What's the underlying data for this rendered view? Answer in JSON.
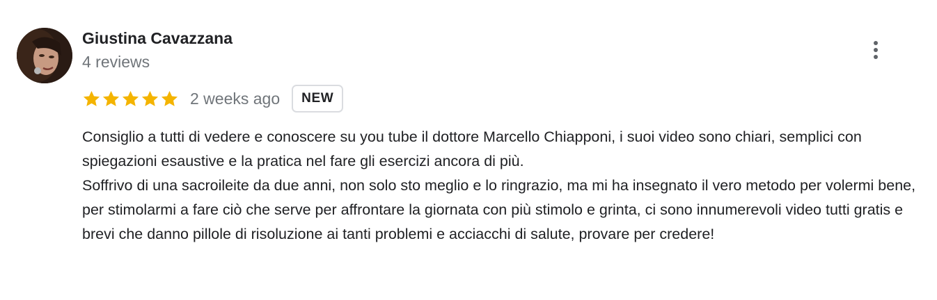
{
  "review": {
    "author_name": "Giustina Cavazzana",
    "review_count": "4 reviews",
    "rating": 5,
    "rating_max": 5,
    "star_color": "#f4b400",
    "time_ago": "2 weeks ago",
    "badge": "NEW",
    "paragraphs": [
      "Consiglio a tutti di vedere e conoscere su you tube il dottore Marcello Chiapponi, i suoi video sono chiari, semplici con spiegazioni esaustive e la pratica nel fare gli esercizi ancora di più.",
      "Soffrivo di una sacroileite da due anni, non solo sto meglio e lo ringrazio, ma mi ha insegnato il vero metodo per volermi bene, per stimolarmi a fare ciò che serve per affrontare la giornata con più stimolo e grinta, ci sono innumerevoli video tutti gratis e brevi che danno pillole di risoluzione ai tanti problemi e acciacchi di salute, provare per credere!"
    ],
    "more_icon": "more-vert-icon"
  }
}
